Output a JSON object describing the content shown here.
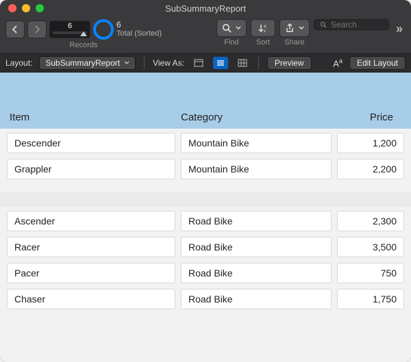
{
  "window": {
    "title": "SubSummaryReport"
  },
  "toolbar": {
    "record_current": "6",
    "total_count": "6",
    "total_label": "Total (Sorted)",
    "records_label": "Records",
    "find_label": "Find",
    "sort_label": "Sort",
    "share_label": "Share",
    "search_placeholder": "Search"
  },
  "layoutbar": {
    "layout_label": "Layout:",
    "layout_selected": "SubSummaryReport",
    "viewas_label": "View As:",
    "preview_label": "Preview",
    "edit_label": "Edit Layout"
  },
  "columns": {
    "item": "Item",
    "category": "Category",
    "price": "Price"
  },
  "groups": [
    {
      "rows": [
        {
          "item": "Descender",
          "category": "Mountain Bike",
          "price": "1,200"
        },
        {
          "item": "Grappler",
          "category": "Mountain Bike",
          "price": "2,200"
        }
      ]
    },
    {
      "rows": [
        {
          "item": "Ascender",
          "category": "Road Bike",
          "price": "2,300"
        },
        {
          "item": "Racer",
          "category": "Road Bike",
          "price": "3,500"
        },
        {
          "item": "Pacer",
          "category": "Road Bike",
          "price": "750"
        },
        {
          "item": "Chaser",
          "category": "Road Bike",
          "price": "1,750"
        }
      ]
    }
  ]
}
